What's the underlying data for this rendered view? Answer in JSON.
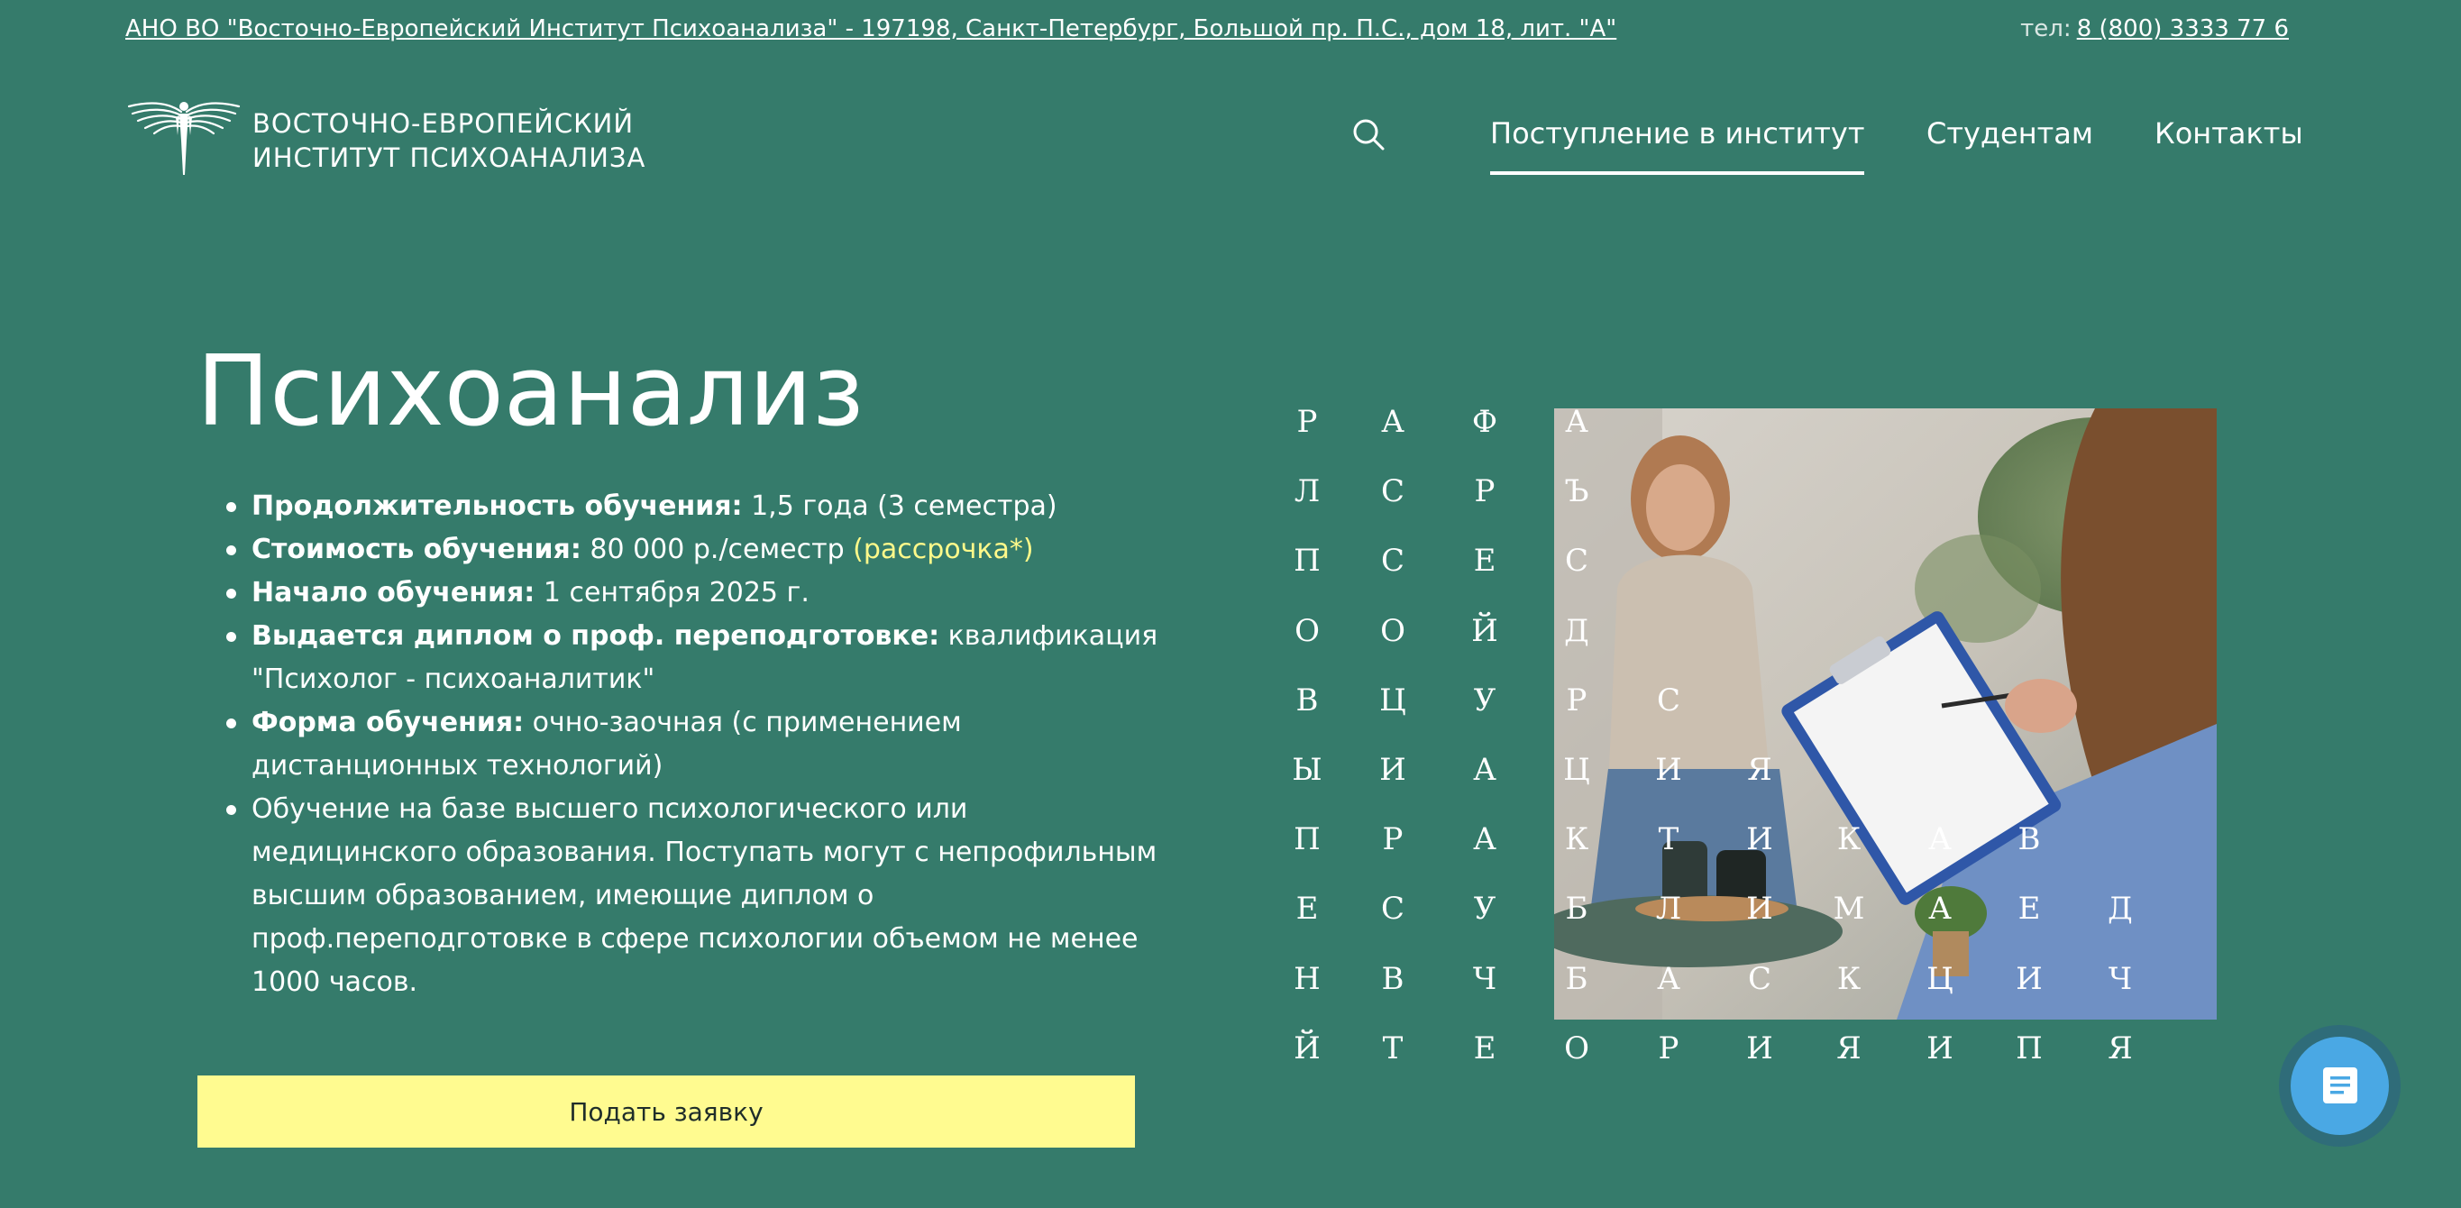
{
  "colors": {
    "background": "#357b6b",
    "accent_yellow": "#fffb90",
    "link_yellow": "#fff98a",
    "chat_button": "#4aa8e4",
    "text": "#ffffff"
  },
  "topbar": {
    "address": "АНО ВО \"Восточно-Европейский Институт Психоанализа\" - 197198, Санкт-Петербург, Большой пр. П.С., дом 18, лит. \"А\"",
    "phone_label": "тел:",
    "phone": "8 (800) 3333 77 6"
  },
  "header": {
    "logo_icon": "winged-figure-logo-icon",
    "brand_line1": "ВОСТОЧНО-ЕВРОПЕЙСКИЙ",
    "brand_line2": "ИНСТИТУТ ПСИХОАНАЛИЗА",
    "nav": [
      {
        "label": "Поступление в институт",
        "active": true
      },
      {
        "label": "Студентам",
        "active": false
      },
      {
        "label": "Контакты",
        "active": false
      }
    ],
    "search_icon": "search-icon"
  },
  "main": {
    "title": "Психоанализ",
    "facts": [
      {
        "label": "Продолжительность обучения:",
        "value": " 1,5 года (3 семестра)"
      },
      {
        "label": "Стоимость обучения:",
        "value": " 80 000 р./семестр ",
        "link": "(рассрочка*)"
      },
      {
        "label": "Начало обучения:",
        "value": " 1 сентября 2025 г."
      },
      {
        "label": "Выдается диплом о проф. переподготовке:",
        "value": " квалификация \"Психолог - психоаналитик\""
      },
      {
        "label": "Форма обучения:",
        "value": " очно-заочная (с применением дистанционных технологий)"
      },
      {
        "label": "",
        "value": "Обучение на базе высшего психологического или медицинского образования. Поступать могут с непрофильным высшим образованием, имеющие диплом о проф.переподготовке в сфере психологии объемом не менее 1000 часов."
      }
    ],
    "apply_button": "Подать заявку"
  },
  "letter_grid": {
    "rows": [
      [
        "Р",
        "А",
        "Ф",
        "А"
      ],
      [
        "Л",
        "С",
        "Р",
        "Ъ"
      ],
      [
        "П",
        "С",
        "Е",
        "С"
      ],
      [
        "О",
        "О",
        "Й",
        "Д"
      ],
      [
        "В",
        "Ц",
        "У",
        "Р",
        "С"
      ],
      [
        "Ы",
        "И",
        "А",
        "Ц",
        "И",
        "Я"
      ],
      [
        "П",
        "Р",
        "А",
        "К",
        "Т",
        "И",
        "К",
        "А",
        "В"
      ],
      [
        "Е",
        "С",
        "У",
        "Б",
        "Л",
        "И",
        "М",
        "А",
        "Е",
        "Д"
      ],
      [
        "Н",
        "В",
        "Ч",
        "Б",
        "А",
        "С",
        "К",
        "Ц",
        "И",
        "Ч"
      ],
      [
        "Й",
        "Т",
        "Е",
        "О",
        "Р",
        "И",
        "Я",
        "И",
        "П",
        "Я"
      ]
    ]
  },
  "photo": {
    "icon": "therapy-session-photo"
  },
  "chat": {
    "icon": "chat-document-icon"
  }
}
